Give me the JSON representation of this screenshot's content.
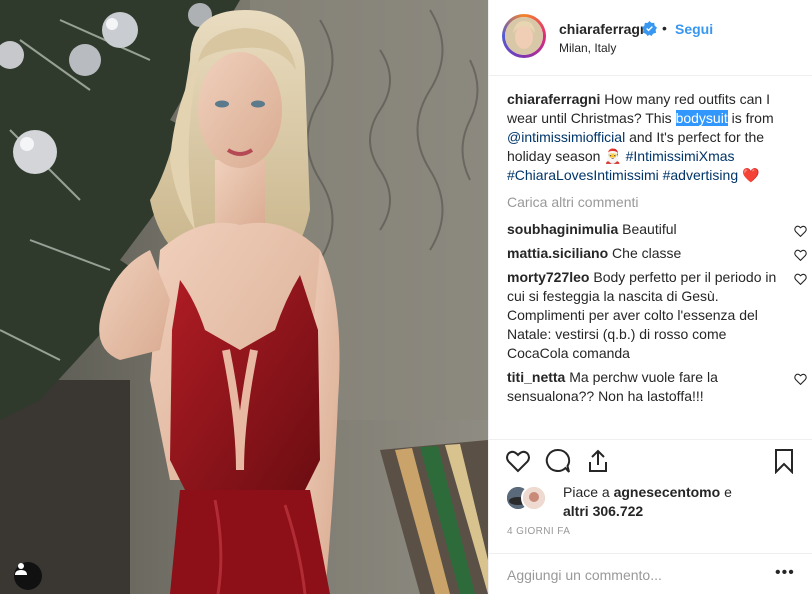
{
  "post": {
    "username": "chiaraferragni",
    "follow_label": "Segui",
    "dot": "•",
    "location": "Milan, Italy"
  },
  "caption": {
    "user": "chiaraferragni",
    "part1": " How many red outfits can I wear until Christmas? This ",
    "highlighted": "bodysuit",
    "part2": " is from ",
    "mention": "@intimissimiofficial",
    "part3": " and It's perfect for the holiday season 🎅 ",
    "tag1": "#IntimissimiXmas",
    "tag2": "#ChiaraLovesIntimissimi",
    "tag3": "#advertising",
    "heart_emoji": "❤️"
  },
  "load_more_label": "Carica altri commenti",
  "comments": [
    {
      "user": "soubhaginimulia",
      "text": " Beautiful"
    },
    {
      "user": "mattia.siciliano",
      "text": " Che classe"
    },
    {
      "user": "morty727leo",
      "text": " Body perfetto per il periodo in cui si festeggia la nascita di Gesù. Complimenti per aver colto l'essenza del Natale: vestirsi (q.b.) di rosso come CocaCola comanda"
    },
    {
      "user": "titi_netta",
      "text": " Ma perchw vuole fare la sensualona?? Non ha lastoffa!!!"
    }
  ],
  "likes": {
    "prefix": "Piace a ",
    "user": "agnesecentomo",
    "middle": " e ",
    "count_text": "altri 306.722"
  },
  "timestamp": "4 GIORNI FA",
  "add_comment": {
    "placeholder": "Aggiungi un commento..."
  },
  "more_options": "•••",
  "icons": {
    "like": "heart-icon",
    "comment": "comment-bubble-icon",
    "share": "share-icon",
    "save": "bookmark-icon",
    "user_tag": "person-icon",
    "verified": "verified-badge-icon"
  },
  "colors": {
    "accent": "#3897f0",
    "link": "#003569",
    "muted": "#999999",
    "heart": "#ed4956"
  }
}
